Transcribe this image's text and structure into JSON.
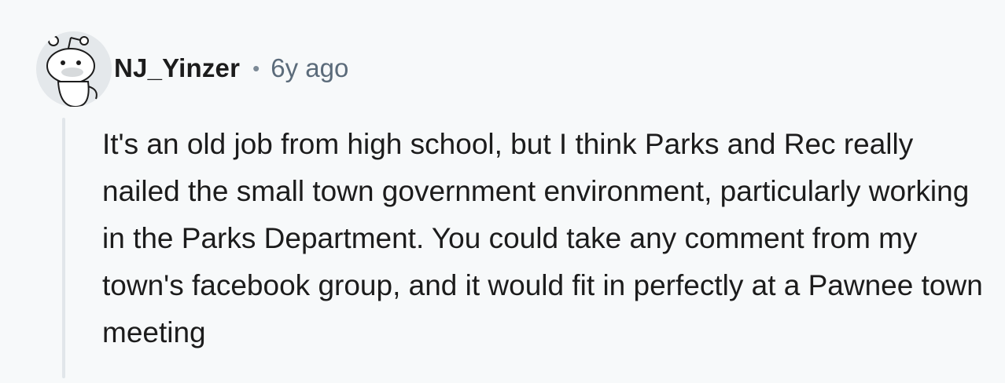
{
  "comment": {
    "author": "NJ_Yinzer",
    "separator": "•",
    "timestamp": "6y ago",
    "avatar_icon": "snoo-avatar-icon",
    "body": "It's an old job from high school, but I think Parks and Rec really nailed the small town government environment, particularly working in the Parks Department. You could take any comment from my town's facebook group, and it would fit in perfectly at a Pawnee town meeting"
  },
  "colors": {
    "background": "#f7f9fa",
    "username": "#1c1c1c",
    "timestamp": "#5b6b7a",
    "body_text": "#1c1c1c",
    "thread_line": "#e1e6ea",
    "avatar_bg": "#e4e8eb"
  }
}
